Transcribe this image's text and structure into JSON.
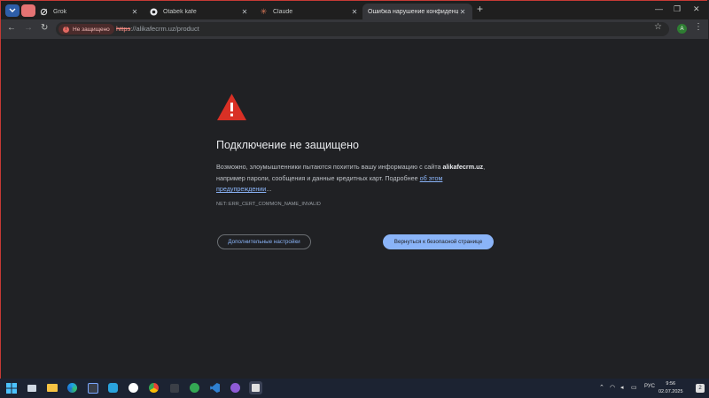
{
  "tabs": [
    {
      "title": "Grok"
    },
    {
      "title": "Otabek kafe"
    },
    {
      "title": "Claude"
    },
    {
      "title": "Ошибка нарушение конфиденц..."
    }
  ],
  "toolbar": {
    "security_chip": "Не защищено",
    "url_protocol": "https",
    "url_rest": "://alikafecrm.uz/product",
    "profile_initial": "A"
  },
  "error_page": {
    "heading": "Подключение не защищено",
    "para_part1": "Возможно, злоумышленники пытаются похитить вашу информацию с сайта ",
    "site": "alikafecrm.uz",
    "para_part2": ", например пароли, сообщения и данные кредитных карт. Подробнее ",
    "learn_more": "об этом предупреждении",
    "para_end": "...",
    "error_code": "NET::ERR_CERT_COMMON_NAME_INVALID",
    "advanced_button": "Дополнительные настройки",
    "back_button": "Вернуться к безопасной странице"
  },
  "taskbar": {
    "language": "РУС",
    "time": "9:56",
    "date": "02.07.2025",
    "notification_count": "2"
  },
  "colors": {
    "warning_red": "#d93025",
    "link_blue": "#8ab4f8",
    "background": "#202124"
  }
}
